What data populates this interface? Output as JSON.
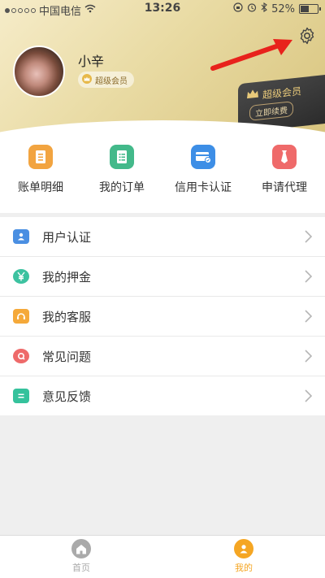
{
  "status_bar": {
    "carrier": "中国电信",
    "time": "13:26",
    "battery": "52%",
    "battery_level": 0.52
  },
  "profile": {
    "username": "小辛",
    "member_badge": "超级会员"
  },
  "vip_card": {
    "title": "超级会员",
    "renew_label": "立即续费"
  },
  "shortcuts": [
    {
      "label": "账单明细",
      "icon": "bill-icon",
      "color": "#f2a440"
    },
    {
      "label": "我的订单",
      "icon": "order-icon",
      "color": "#43b98a"
    },
    {
      "label": "信用卡认证",
      "icon": "credit-card-icon",
      "color": "#3d8ee6"
    },
    {
      "label": "申请代理",
      "icon": "tie-icon",
      "color": "#ef6a6a"
    }
  ],
  "menu": [
    {
      "label": "用户认证",
      "icon": "user-id-icon",
      "color": "#4a8fe2"
    },
    {
      "label": "我的押金",
      "icon": "yen-icon",
      "color": "#3cc2a0"
    },
    {
      "label": "我的客服",
      "icon": "service-icon",
      "color": "#f5a93a"
    },
    {
      "label": "常见问题",
      "icon": "question-icon",
      "color": "#ee6a6a"
    },
    {
      "label": "意见反馈",
      "icon": "feedback-icon",
      "color": "#35c29c"
    }
  ],
  "tabbar": {
    "home_label": "首页",
    "mine_label": "我的",
    "active_color": "#f5a623",
    "inactive_color": "#aaaaaa"
  }
}
